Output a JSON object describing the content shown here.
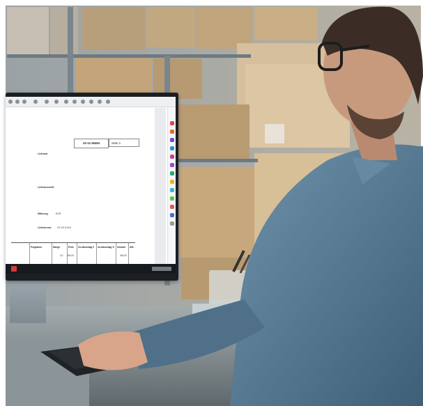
{
  "document": {
    "doc_number": "4X-11-45454",
    "page_label": "Seite 1",
    "supplier_label": "Lieferant",
    "delivery_label": "Lieferanschrift",
    "currency_label": "Währung",
    "currency_value": "EUR",
    "delivery_date_label": "Liefertermin",
    "delivery_date_value": "XX.XX.XXXX",
    "table": {
      "headers": [
        "Programm",
        "Menge",
        "Preis",
        "Zu-/Abschlag €",
        "Zu-/Abschlag %",
        "Gesamt",
        "USt."
      ],
      "row": {
        "menge": "3,0",
        "preis": "304,00",
        "gesamt": "304,00"
      },
      "summary": [
        {
          "label": "Gesamtnettowert €",
          "value": "304,00"
        },
        {
          "label": "Rechnungsbetrag",
          "value": "1.000,00"
        }
      ]
    }
  },
  "colors": {
    "monitor_bezel": "#1b1f24",
    "shirt": "#5b7f99",
    "boxes": "#c9a777",
    "shelf": "#6c7a83",
    "desk": "#8b9498"
  }
}
